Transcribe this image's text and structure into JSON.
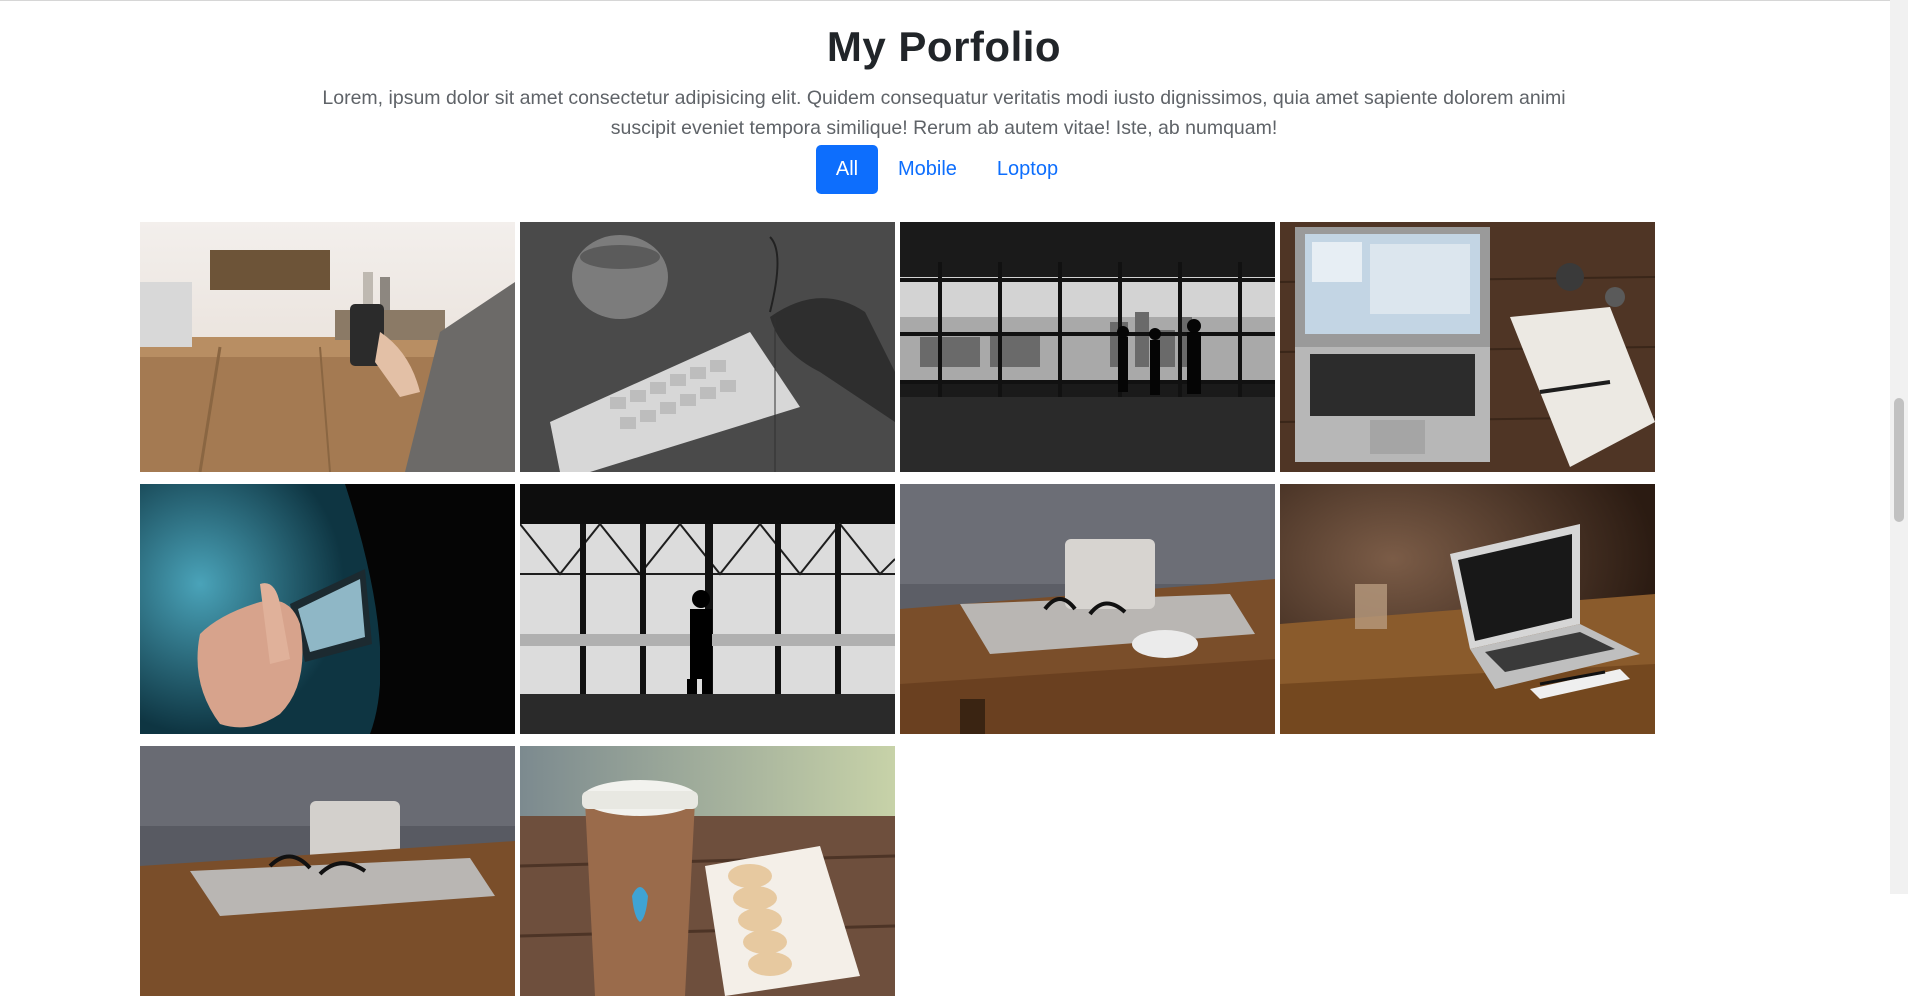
{
  "portfolio": {
    "title": "My Porfolio",
    "description": "Lorem, ipsum dolor sit amet consectetur adipisicing elit. Quidem consequatur veritatis modi iusto dignissimos, quia amet sapiente dolorem animi suscipit eveniet tempora similique! Rerum ab autem vitae! Iste, ab numquam!",
    "filters": [
      {
        "label": "All",
        "active": true
      },
      {
        "label": "Mobile",
        "active": false
      },
      {
        "label": "Loptop",
        "active": false
      }
    ]
  },
  "gallery": [
    {
      "subject": "phone-on-wooden-table"
    },
    {
      "subject": "keyboard-and-mug-monochrome"
    },
    {
      "subject": "office-window-silhouettes-monochrome"
    },
    {
      "subject": "macbook-top-view-with-notebook"
    },
    {
      "subject": "hand-holding-phone-blue"
    },
    {
      "subject": "person-silhouette-at-window-monochrome"
    },
    {
      "subject": "laptop-glasses-mouse-on-desk"
    },
    {
      "subject": "open-laptop-on-wooden-table"
    },
    {
      "subject": "laptop-and-glasses-on-desk"
    },
    {
      "subject": "coffee-cup-and-macarons"
    }
  ],
  "colors": {
    "accent": "#0d6efd",
    "title": "#212529",
    "text": "#5f6368"
  }
}
